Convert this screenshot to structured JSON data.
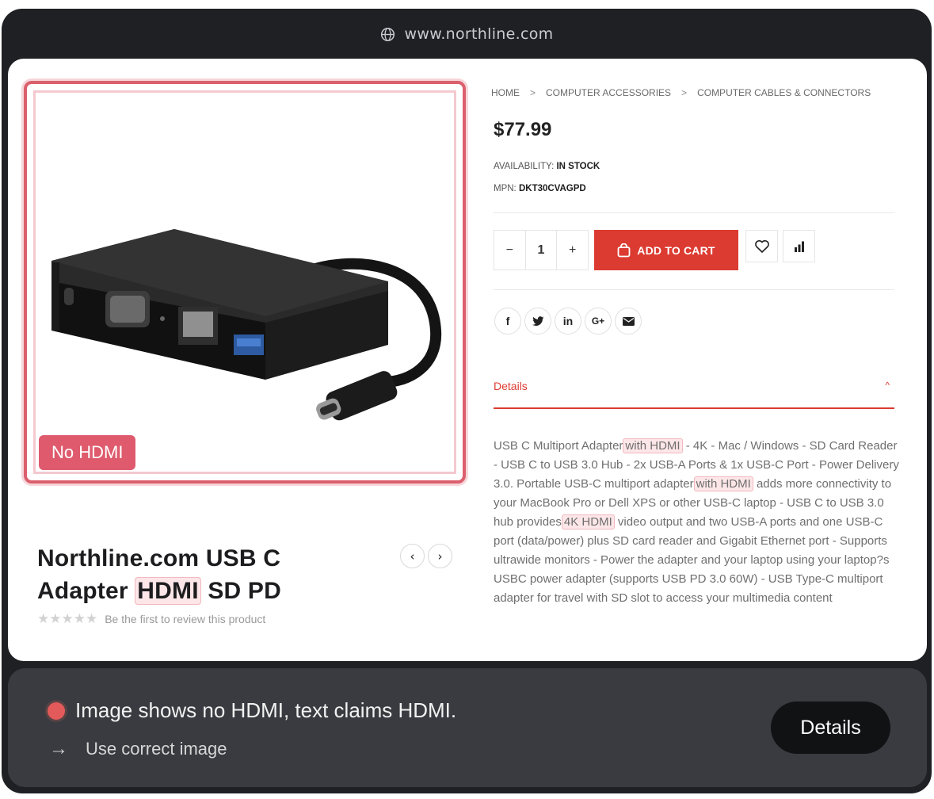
{
  "browser": {
    "url": "www.northline.com",
    "url_icon": "globe-icon"
  },
  "product_image": {
    "badge": "No HDMI"
  },
  "product": {
    "name_part1": "Northline.com USB C",
    "name_part2": "Adapter",
    "name_highlight": "HDMI",
    "name_part3": "SD PD",
    "review_text": "Be the first to review this product",
    "rating": 0,
    "max_rating": 5
  },
  "breadcrumb": [
    "HOME",
    "COMPUTER ACCESSORIES",
    "COMPUTER CABLES & CONNECTORS"
  ],
  "price": "$77.99",
  "availability": {
    "label": "AVAILABILITY:",
    "value": "IN STOCK"
  },
  "mpn": {
    "label": "MPN:",
    "value": "DKT30CVAGPD"
  },
  "quantity": {
    "minus": "−",
    "value": "1",
    "plus": "+"
  },
  "add_to_cart": "ADD TO CART",
  "details_tab": {
    "label": "Details",
    "toggle": "^"
  },
  "description": {
    "seg1": "USB C Multiport Adapter",
    "hl1": "with HDMI",
    "seg2": " - 4K - Mac / Windows - SD Card Reader - USB C to USB 3.0 Hub - 2x USB-A Ports & 1x USB-C Port - Power Delivery 3.0. Portable USB-C multiport adapter",
    "hl2": "with HDMI",
    "seg3": " adds more connectivity to your MacBook Pro or Dell XPS or other USB-C laptop - USB C to USB 3.0 hub provides",
    "hl3": "4K HDMI",
    "seg4": " video output and two USB-A ports and one USB-C port (data/power) plus SD card reader and Gigabit Ethernet port - Supports ultrawide monitors - Power the adapter and your laptop using your laptop?s USBC power adapter (supports USB PD 3.0 60W) - USB Type-C multiport adapter for travel with SD slot to access your multimedia content"
  },
  "issue_panel": {
    "message": "Image shows no HDMI, text claims HDMI.",
    "suggestion": "Use correct image",
    "button": "Details",
    "status_color": "#e35a5a"
  },
  "colors": {
    "accent": "#dc3b31",
    "highlight_border": "#db5f6d"
  }
}
